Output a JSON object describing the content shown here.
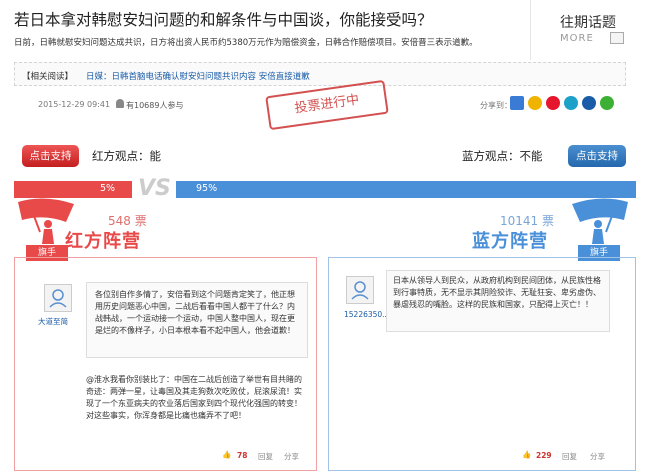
{
  "header": {
    "title": "若日本拿对韩慰安妇问题的和解条件与中国谈，你能接受吗？",
    "description": "日前，日韩就慰安妇问题达成共识，日方将出资人民币约5380万元作为赔偿资金，日韩合作赔偿项目。安倍晋三表示道歉。",
    "past_topics": "往期话题",
    "more": "MORE"
  },
  "related": {
    "label": "【相关阅读】",
    "link": "日媒：日韩首脑电话确认慰安妇问题共识内容 安倍直接道歉"
  },
  "meta": {
    "date": "2015-12-29 09:41",
    "participants": "有10689人参与",
    "stamp": "投票进行中",
    "share_label": "分享到："
  },
  "share_icons": [
    "plus-icon",
    "star-icon",
    "weibo-icon",
    "pinterest-icon",
    "renren-icon",
    "wechat-icon"
  ],
  "colors": {
    "red": "#e84a4a",
    "blue": "#4a90d9"
  },
  "red": {
    "support_button": "点击支持",
    "view": "红方观点：能",
    "percent": "5%",
    "votes": "548 票",
    "camp": "红方阵营",
    "flag_tag": "旗手",
    "comment": {
      "user": "大道至简",
      "text": "各位别自作多情了，安倍看到这个问题肯定笑了，他正想用历史问题恶心中国，二战后看看中国人都干了什么？内战韩战，一个运动接一个运动，中国人整中国人，现在更是烂的不像样子，小日本根本看不起中国人，他会道歉！",
      "reply": "@淮水我看你别装比了：中国在二战后创造了举世有目共睹的奇迹：两弹一星，让毒国及其走狗数次吃败仗，屁滚尿流！实现了一个东亚病夫的农业落后国家到四个现代化强国的转变！对这些事实，你浑身都是比痛也痛弄不了吧！",
      "likes": "78",
      "reply_label": "回复",
      "share_label": "分享"
    }
  },
  "blue": {
    "support_button": "点击支持",
    "view": "蓝方观点：不能",
    "percent": "95%",
    "votes": "10141 票",
    "camp": "蓝方阵营",
    "flag_tag": "旗手",
    "comment": {
      "user": "15226350...",
      "text": "日本从领导人到民众，从政府机构到民间团体，从民族性格到行事特质，无不显示其阴险狡诈、无耻狂妄、卑劣虚伪、暴虐残忍的嘴脸。这样的民族和国家，只配得上灭亡！！",
      "likes": "229",
      "reply_label": "回复",
      "share_label": "分享"
    }
  },
  "vs": "VS"
}
